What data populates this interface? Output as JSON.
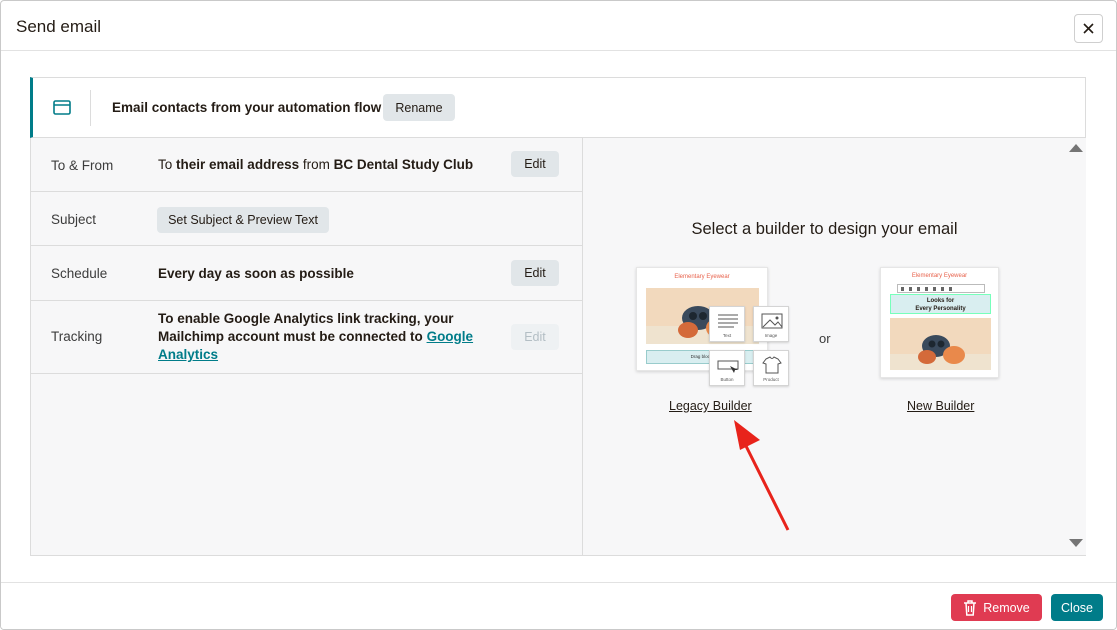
{
  "modal": {
    "title": "Send email",
    "close_icon": "close-icon"
  },
  "flow": {
    "icon": "mail-icon",
    "text": "Email contacts from your automation flow",
    "rename_label": "Rename",
    "accent_color": "#007c89"
  },
  "rows": {
    "to_from": {
      "label": "To & From",
      "to_prefix": "To",
      "to_value": "their email address",
      "from_prefix": "from",
      "from_value": "BC Dental Study Club",
      "edit_label": "Edit"
    },
    "subject": {
      "label": "Subject",
      "button_label": "Set Subject & Preview Text"
    },
    "schedule": {
      "label": "Schedule",
      "value": "Every day as soon as possible",
      "edit_label": "Edit"
    },
    "tracking": {
      "label": "Tracking",
      "text": "To enable Google Analytics link tracking, your Mailchimp account must be connected to",
      "link_text": "Google Analytics",
      "edit_label": "Edit"
    }
  },
  "builder": {
    "title": "Select a builder to design your email",
    "or_text": "or",
    "legacy": {
      "link_label": "Legacy Builder",
      "preview_header": "Elementary Eyewear",
      "preview_button": "Drag blocks",
      "blocks": [
        "Text",
        "Image",
        "Button",
        "Product"
      ]
    },
    "new": {
      "link_label": "New Builder",
      "preview_header": "Elementary Eyewear",
      "preview_headline_1": "Looks for",
      "preview_headline_2": "Every Personality"
    }
  },
  "footer": {
    "remove_label": "Remove",
    "close_label": "Close",
    "remove_color": "#e03b52",
    "close_color": "#007c89"
  }
}
